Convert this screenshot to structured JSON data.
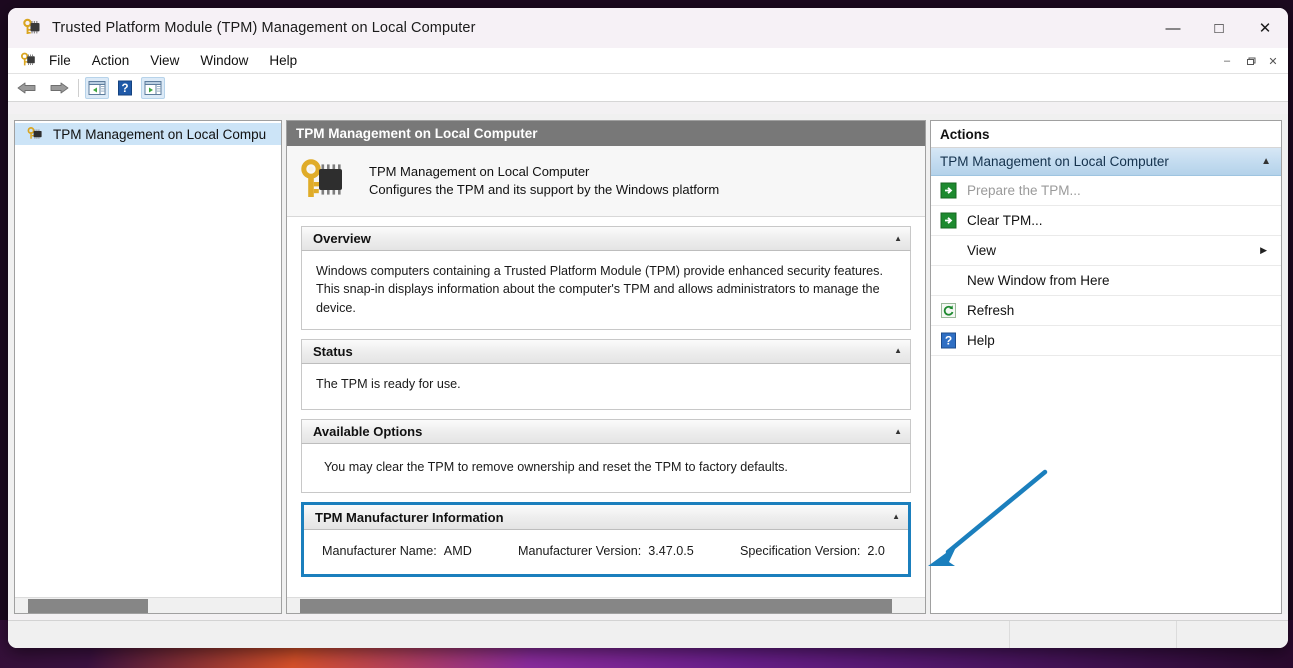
{
  "window": {
    "title": "Trusted Platform Module (TPM) Management on Local Computer",
    "title_icon": "tpm-key-chip-icon",
    "minimize_label": "—",
    "maximize_label": "□",
    "close_label": "✕"
  },
  "menubar": {
    "icon": "console-root-icon",
    "items": [
      {
        "label": "File"
      },
      {
        "label": "Action"
      },
      {
        "label": "View"
      },
      {
        "label": "Window"
      },
      {
        "label": "Help"
      }
    ],
    "mdi_controls": {
      "minimize": "–",
      "restore": "❐",
      "close": "✕"
    }
  },
  "toolbar": {
    "back_icon": "back-arrow-icon",
    "forward_icon": "forward-arrow-icon",
    "show_tree_icon": "show-hide-tree-icon",
    "help_icon": "help-question-icon",
    "show_actions_icon": "show-hide-action-pane-icon"
  },
  "tree": {
    "item_icon": "tpm-node-icon",
    "item_label": "TPM Management on Local Compu"
  },
  "content": {
    "title": "TPM Management on Local Computer",
    "banner_icon": "gold-key-chip-icon",
    "banner_title": "TPM Management on Local Computer",
    "banner_subtitle": "Configures the TPM and its support by the Windows platform",
    "collapse_chevron": "▲",
    "sections": [
      {
        "title": "Overview",
        "text": "Windows computers containing a Trusted Platform Module (TPM) provide enhanced security features. This snap-in displays information about the computer's TPM and allows administrators to manage the device."
      },
      {
        "title": "Status",
        "text": "The TPM is ready for use."
      },
      {
        "title": "Available Options",
        "text": "You may clear the TPM to remove ownership and reset the TPM to factory defaults."
      }
    ],
    "manufacturer_section": {
      "title": "TPM Manufacturer Information",
      "highlight_color": "#1b7fbd",
      "fields": [
        {
          "label": "Manufacturer Name:",
          "value": "AMD"
        },
        {
          "label": "Manufacturer Version:",
          "value": "3.47.0.5"
        },
        {
          "label": "Specification Version:",
          "value": "2.0"
        }
      ]
    }
  },
  "actions": {
    "title": "Actions",
    "group_title": "TPM Management on Local Computer",
    "group_chevron": "▲",
    "items": [
      {
        "label": "Prepare the TPM...",
        "icon": "green-arrow-icon",
        "disabled": true
      },
      {
        "label": "Clear TPM...",
        "icon": "green-arrow-icon",
        "disabled": false
      },
      {
        "label": "View",
        "icon": "",
        "submenu_arrow": "▶",
        "disabled": false
      },
      {
        "label": "New Window from Here",
        "icon": "",
        "disabled": false
      },
      {
        "label": "Refresh",
        "icon": "refresh-icon",
        "disabled": false
      },
      {
        "label": "Help",
        "icon": "help-question-icon",
        "disabled": false
      }
    ]
  },
  "scrollbars": {
    "tree_thumb_label": "tree-horizontal-scrollbar",
    "content_thumb_label": "content-horizontal-scrollbar"
  },
  "annotation": {
    "arrow_color": "#1b7fbd",
    "label": "pointer-arrow-to-manufacturer-info"
  }
}
